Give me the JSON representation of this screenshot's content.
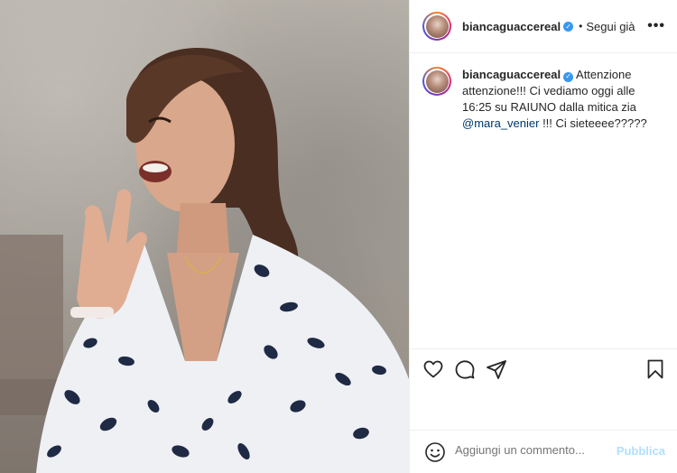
{
  "post": {
    "username": "biancaguaccereal",
    "follow_label": "Segui già",
    "separator": "•",
    "more_label": "•••",
    "verified_mark": "✓"
  },
  "caption": {
    "username": "biancaguaccereal",
    "text_before": " Attenzione attenzione!!! Ci vediamo oggi alle 16:25 su RAIUNO dalla mitica zia ",
    "mention": "@mara_venier",
    "text_after": " !!! Ci sieteeee?????"
  },
  "actions": {
    "like_icon": "heart-icon",
    "comment_icon": "comment-icon",
    "share_icon": "share-icon",
    "save_icon": "bookmark-icon"
  },
  "comment": {
    "placeholder": "Aggiungi un commento...",
    "publish_label": "Pubblica"
  },
  "colors": {
    "verified": "#3897f0",
    "mention": "#00376b",
    "publish_disabled": "#b2dffc",
    "border": "#efefef"
  }
}
